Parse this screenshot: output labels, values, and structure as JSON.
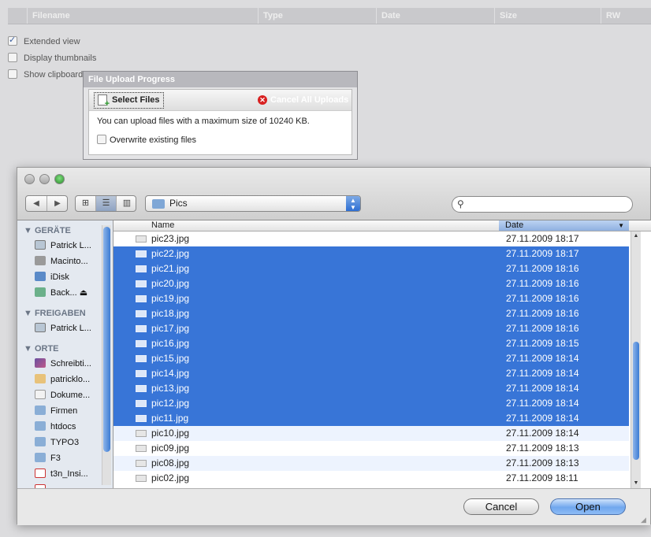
{
  "bg_table": {
    "columns": [
      "Filename",
      "Type",
      "Date",
      "Size",
      "RW"
    ]
  },
  "options": [
    {
      "label": "Extended view",
      "checked": true
    },
    {
      "label": "Display thumbnails",
      "checked": false
    },
    {
      "label": "Show clipboard",
      "checked": false
    }
  ],
  "upload": {
    "title": "File Upload Progress",
    "select_label": "Select Files",
    "cancel_label": "Cancel All Uploads",
    "message": "You can upload files with a maximum size of 10240 KB.",
    "overwrite_label": "Overwrite existing files"
  },
  "dialog": {
    "path": "Pics",
    "search_placeholder": "",
    "sidebar": {
      "sections": [
        {
          "title": "GERÄTE",
          "items": [
            "Patrick L...",
            "Macinto...",
            "iDisk",
            "Back..."
          ]
        },
        {
          "title": "FREIGABEN",
          "items": [
            "Patrick L..."
          ]
        },
        {
          "title": "ORTE",
          "items": [
            "Schreibti...",
            "patricklo...",
            "Dokume...",
            "Firmen",
            "htdocs",
            "TYPO3",
            "F3",
            "t3n_Insi..."
          ]
        }
      ]
    },
    "columns": {
      "name": "Name",
      "date": "Date"
    },
    "files": [
      {
        "name": "pic23.jpg",
        "date": "27.11.2009 18:17",
        "selected": false
      },
      {
        "name": "pic22.jpg",
        "date": "27.11.2009 18:17",
        "selected": true
      },
      {
        "name": "pic21.jpg",
        "date": "27.11.2009 18:16",
        "selected": true
      },
      {
        "name": "pic20.jpg",
        "date": "27.11.2009 18:16",
        "selected": true
      },
      {
        "name": "pic19.jpg",
        "date": "27.11.2009 18:16",
        "selected": true
      },
      {
        "name": "pic18.jpg",
        "date": "27.11.2009 18:16",
        "selected": true
      },
      {
        "name": "pic17.jpg",
        "date": "27.11.2009 18:16",
        "selected": true
      },
      {
        "name": "pic16.jpg",
        "date": "27.11.2009 18:15",
        "selected": true
      },
      {
        "name": "pic15.jpg",
        "date": "27.11.2009 18:14",
        "selected": true
      },
      {
        "name": "pic14.jpg",
        "date": "27.11.2009 18:14",
        "selected": true
      },
      {
        "name": "pic13.jpg",
        "date": "27.11.2009 18:14",
        "selected": true
      },
      {
        "name": "pic12.jpg",
        "date": "27.11.2009 18:14",
        "selected": true
      },
      {
        "name": "pic11.jpg",
        "date": "27.11.2009 18:14",
        "selected": true
      },
      {
        "name": "pic10.jpg",
        "date": "27.11.2009 18:14",
        "selected": false
      },
      {
        "name": "pic09.jpg",
        "date": "27.11.2009 18:13",
        "selected": false
      },
      {
        "name": "pic08.jpg",
        "date": "27.11.2009 18:13",
        "selected": false
      },
      {
        "name": "pic02.jpg",
        "date": "27.11.2009 18:11",
        "selected": false
      }
    ],
    "cancel_label": "Cancel",
    "open_label": "Open"
  }
}
